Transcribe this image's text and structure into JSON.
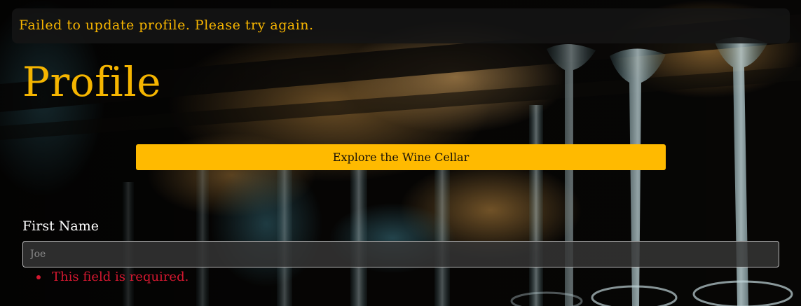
{
  "alert": {
    "message": "Failed to update profile. Please try again."
  },
  "header": {
    "title": "Profile"
  },
  "actions": {
    "explore_label": "Explore the Wine Cellar"
  },
  "form": {
    "first_name": {
      "label": "First Name",
      "value": "",
      "placeholder": "Joe",
      "errors": [
        "This field is required."
      ]
    }
  },
  "colors": {
    "accent": "#ffba00",
    "title": "#f5b500",
    "error": "#d41830",
    "alert_background": "#141414"
  },
  "background": {
    "icon": "wine-glasses-bar-photo"
  }
}
